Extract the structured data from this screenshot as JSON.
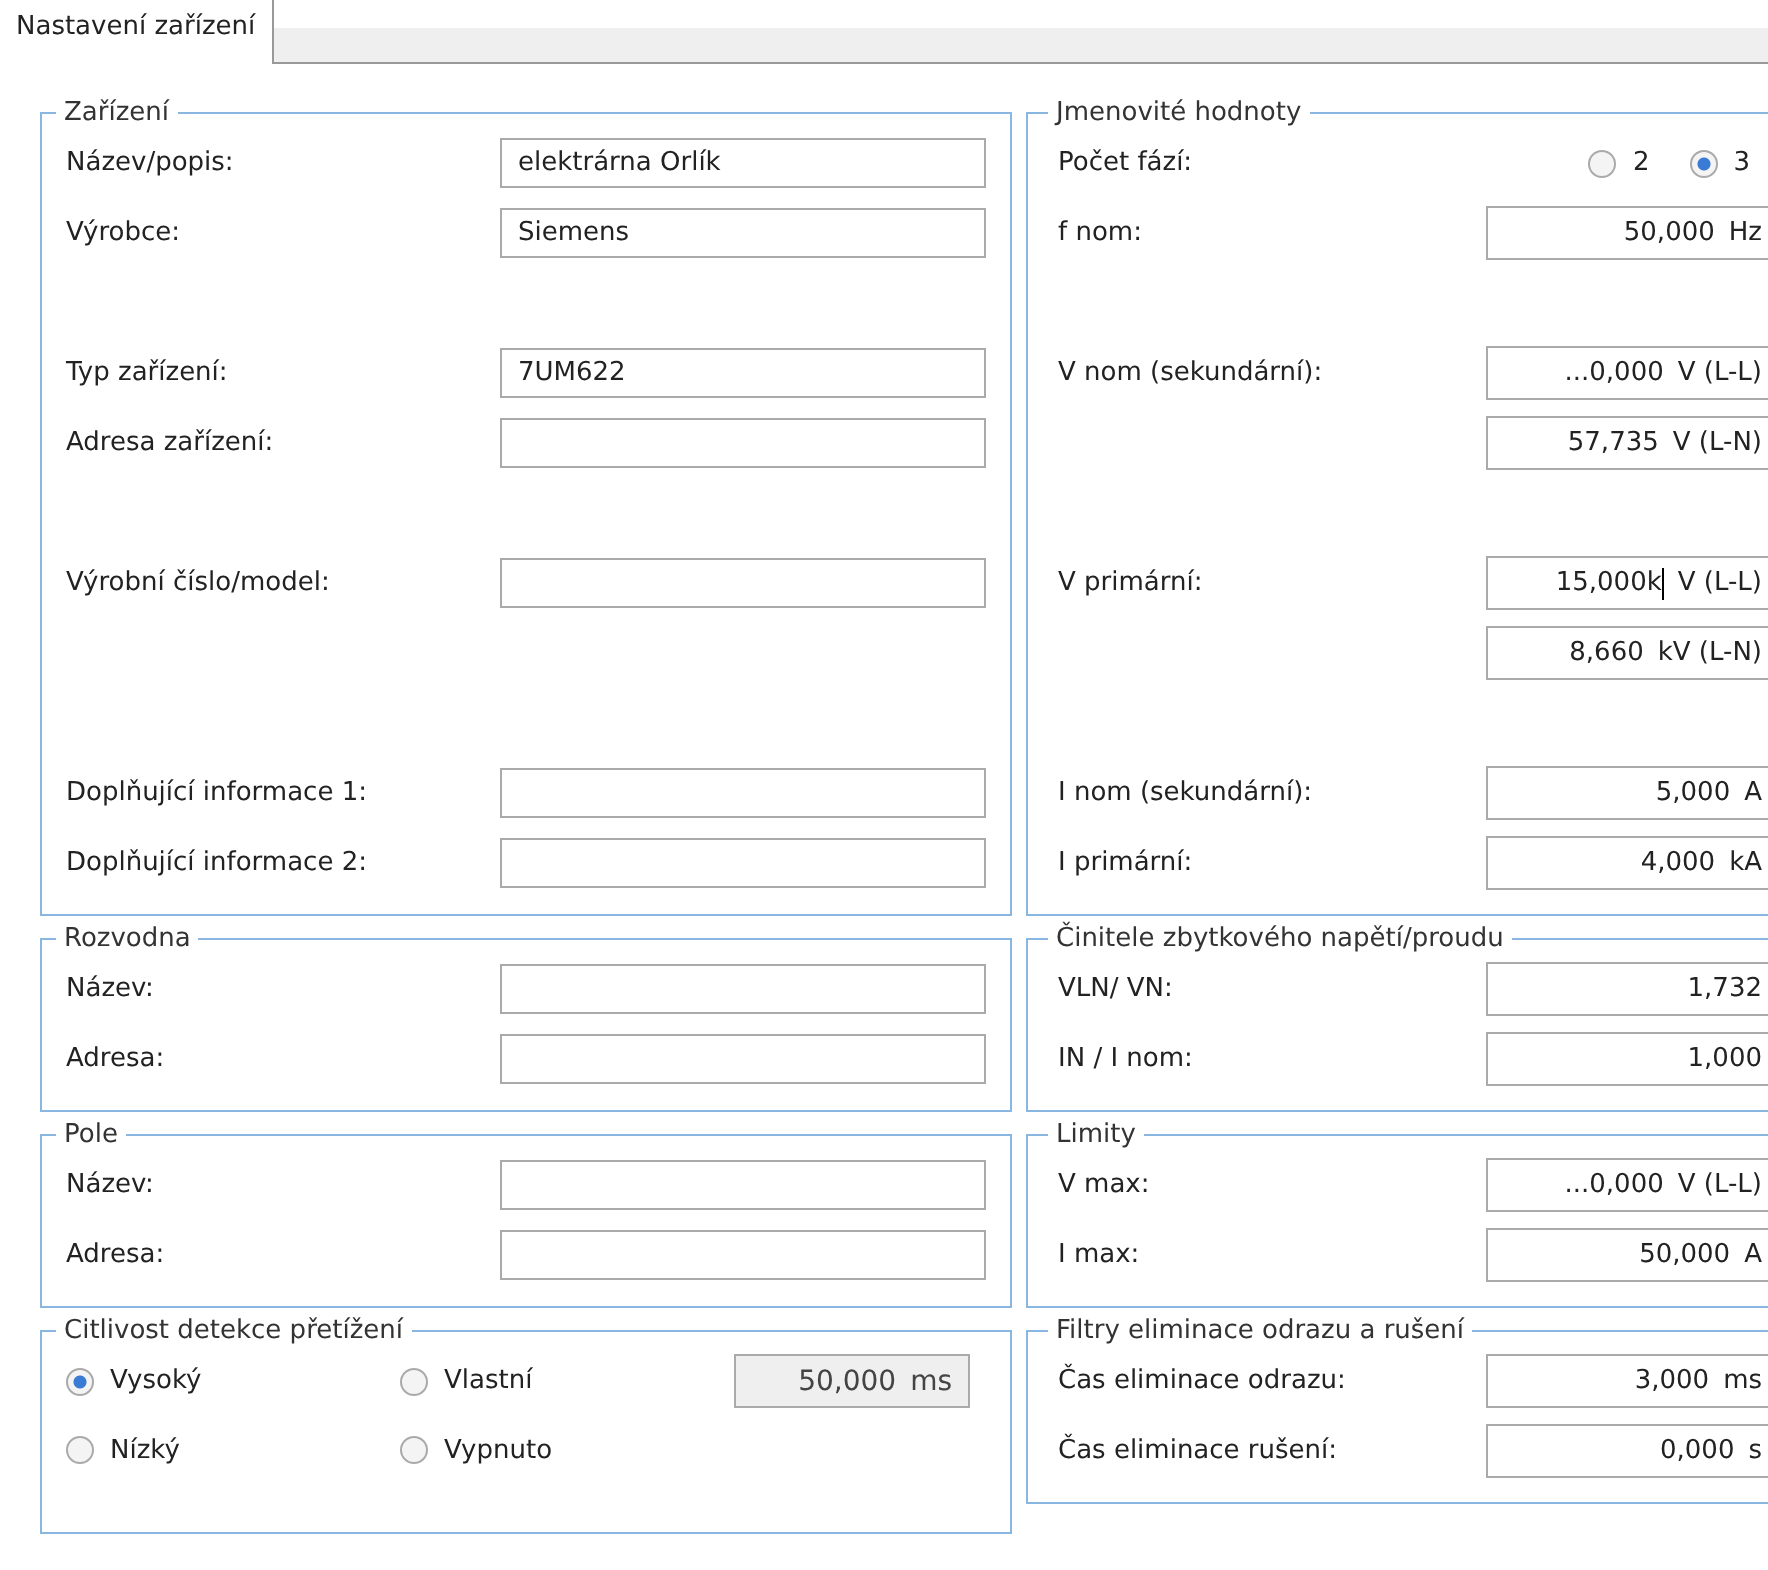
{
  "tabs": [
    {
      "label": "Nastavení zařízení",
      "selected": true
    }
  ],
  "left_groups": [
    {
      "title": "Zařízení",
      "kind": "fields",
      "rows": [
        {
          "kind": "field",
          "label": "Název/popis:",
          "value": "elektrárna Orlík"
        },
        {
          "kind": "field",
          "label": "Výrobce:",
          "value": "Siemens"
        },
        {
          "kind": "blank"
        },
        {
          "kind": "field",
          "label": "Typ zařízení:",
          "value": "7UM622"
        },
        {
          "kind": "field",
          "label": "Adresa zařízení:"
        },
        {
          "kind": "blank"
        },
        {
          "kind": "field",
          "label": "Výrobní číslo/model:"
        },
        {
          "kind": "blank"
        },
        {
          "kind": "blank"
        },
        {
          "kind": "field",
          "label": "Doplňující informace 1:"
        },
        {
          "kind": "field",
          "label": "Doplňující informace 2:"
        }
      ]
    },
    {
      "title": "Rozvodna",
      "kind": "fields",
      "rows": [
        {
          "kind": "field",
          "label": "Název:"
        },
        {
          "kind": "field",
          "label": "Adresa:"
        }
      ]
    },
    {
      "title": "Pole",
      "kind": "fields",
      "rows": [
        {
          "kind": "field",
          "label": "Název:"
        },
        {
          "kind": "field",
          "label": "Adresa:"
        }
      ]
    },
    {
      "title": "Citlivost detekce přetížení",
      "kind": "options",
      "options": [
        {
          "label": "Vysoký",
          "selected": true
        },
        {
          "label": "Vlastní",
          "selected": false
        },
        {
          "label": "Nízký",
          "selected": false
        },
        {
          "label": "Vypnuto",
          "selected": false
        }
      ],
      "field": {
        "value": "50,000",
        "unit": "ms",
        "disabled": true
      }
    }
  ],
  "right_groups": [
    {
      "title": "Jmenovité hodnoty",
      "rows": [
        {
          "kind": "radio",
          "label": "Počet fází:",
          "options": [
            {
              "label": "2",
              "selected": false
            },
            {
              "label": "3",
              "selected": true
            }
          ]
        },
        {
          "kind": "field",
          "label": "f nom:",
          "value": "50,000",
          "unit": "Hz"
        },
        {
          "kind": "blank"
        },
        {
          "kind": "field",
          "label": "V nom (sekundární):",
          "value": "...0,000",
          "unit": "V (L-L)"
        },
        {
          "kind": "field",
          "value": "57,735",
          "unit": "V (L-N)"
        },
        {
          "kind": "blank"
        },
        {
          "kind": "field",
          "label": "V primární:",
          "value": "15,000k",
          "unit": "V (L-L)",
          "focused": true
        },
        {
          "kind": "field",
          "value": "8,660",
          "unit": "kV (L-N)"
        },
        {
          "kind": "blank"
        },
        {
          "kind": "field",
          "label": "I nom (sekundární):",
          "value": "5,000",
          "unit": "A"
        },
        {
          "kind": "field",
          "label": "I primární:",
          "value": "4,000",
          "unit": "kA"
        }
      ]
    },
    {
      "title": "Činitele zbytkového napětí/proudu",
      "rows": [
        {
          "kind": "field",
          "label": "VLN/ VN:",
          "value": "1,732"
        },
        {
          "kind": "field",
          "label": "IN / I nom:",
          "value": "1,000"
        }
      ]
    },
    {
      "title": "Limity",
      "rows": [
        {
          "kind": "field",
          "label": "V max:",
          "value": "...0,000",
          "unit": "V (L-L)"
        },
        {
          "kind": "field",
          "label": "I max:",
          "value": "50,000",
          "unit": "A"
        }
      ]
    },
    {
      "title": "Filtry eliminace odrazu a rušení",
      "rows": [
        {
          "kind": "field",
          "label": "Čas eliminace odrazu:",
          "value": "3,000",
          "unit": "ms"
        },
        {
          "kind": "field",
          "label": "Čas eliminace rušení:",
          "value": "0,000",
          "unit": "s"
        }
      ]
    }
  ]
}
